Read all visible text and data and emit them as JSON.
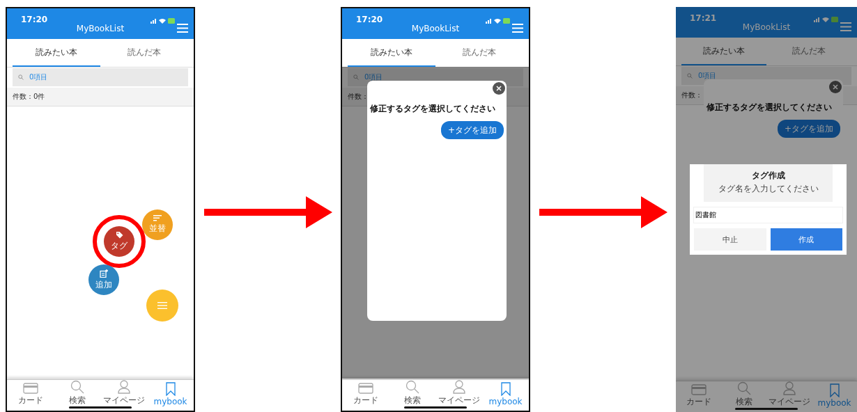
{
  "screens": [
    {
      "status_time": "17:20",
      "title": "MyBookList",
      "tabs": [
        {
          "label": "読みたい本",
          "selected": true
        },
        {
          "label": "読んだ本",
          "selected": false
        }
      ],
      "search": {
        "label": "0項目"
      },
      "count": "件数：0件",
      "fab_actions": [
        {
          "label": "並替",
          "color": "#f0a020",
          "highlighted": false
        },
        {
          "label": "タグ",
          "color": "#c0392b",
          "highlighted": true
        },
        {
          "label": "追加",
          "color": "#2e86c1",
          "highlighted": false
        }
      ],
      "fab_main": {
        "color": "#fbc02d"
      },
      "nav": [
        {
          "label": "カード",
          "selected": false
        },
        {
          "label": "検索",
          "selected": false
        },
        {
          "label": "マイページ",
          "selected": false
        },
        {
          "label": "mybook",
          "selected": true
        }
      ]
    },
    {
      "status_time": "17:20",
      "title": "MyBookList",
      "tabs": [
        {
          "label": "読みたい本",
          "selected": true
        },
        {
          "label": "読んだ本",
          "selected": false
        }
      ],
      "search": {
        "label": "0項目"
      },
      "count": "件数：",
      "dialog": {
        "title": "修正するタグを選択してください",
        "add_button": "+タグを追加"
      },
      "nav": [
        {
          "label": "カード",
          "selected": false
        },
        {
          "label": "検索",
          "selected": false
        },
        {
          "label": "マイページ",
          "selected": false
        },
        {
          "label": "mybook",
          "selected": true
        }
      ]
    },
    {
      "status_time": "17:21",
      "title": "MyBookList",
      "tabs": [
        {
          "label": "読みたい本",
          "selected": true
        },
        {
          "label": "読んだ本",
          "selected": false
        }
      ],
      "search": {
        "label": "0項目"
      },
      "count": "件数：",
      "dialog": {
        "title": "修正するタグを選択してください",
        "add_button": "+タグを追加"
      },
      "prompt": {
        "title": "タグ作成",
        "message": "タグ名を入力してください",
        "value": "図書館",
        "cancel": "中止",
        "confirm": "作成"
      },
      "nav": [
        {
          "label": "カード",
          "selected": false
        },
        {
          "label": "検索",
          "selected": false
        },
        {
          "label": "マイページ",
          "selected": false
        },
        {
          "label": "mybook",
          "selected": true
        }
      ]
    }
  ]
}
